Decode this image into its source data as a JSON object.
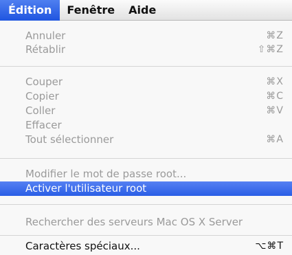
{
  "menubar": {
    "items": [
      "Édition",
      "Fenêtre",
      "Aide"
    ]
  },
  "menu": {
    "items": [
      {
        "label": "Annuler",
        "shortcut": "⌘Z",
        "enabled": false
      },
      {
        "label": "Rétablir",
        "shortcut": "⇧⌘Z",
        "enabled": false
      },
      {
        "label": "Couper",
        "shortcut": "⌘X",
        "enabled": false
      },
      {
        "label": "Copier",
        "shortcut": "⌘C",
        "enabled": false
      },
      {
        "label": "Coller",
        "shortcut": "⌘V",
        "enabled": false
      },
      {
        "label": "Effacer",
        "shortcut": "",
        "enabled": false
      },
      {
        "label": "Tout sélectionner",
        "shortcut": "⌘A",
        "enabled": false
      },
      {
        "label": "Modifier le mot de passe root...",
        "shortcut": "",
        "enabled": false
      },
      {
        "label": "Activer l'utilisateur root",
        "shortcut": "",
        "enabled": true,
        "selected": true
      },
      {
        "label": "Rechercher des serveurs Mac OS X Server",
        "shortcut": "",
        "enabled": false
      },
      {
        "label": "Caractères spéciaux...",
        "shortcut": "⌥⌘T",
        "enabled": true
      }
    ]
  },
  "colors": {
    "accent": "#2a5ee6",
    "disabled_text": "#9a9a9a",
    "enabled_text": "#111111"
  }
}
